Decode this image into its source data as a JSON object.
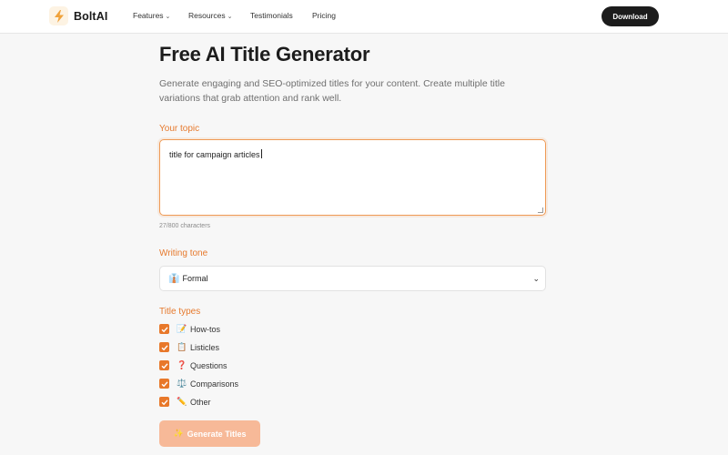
{
  "navbar": {
    "brand": "BoltAI",
    "logo_icon": "lightning-bolt-icon",
    "items": [
      {
        "label": "Features",
        "has_dropdown": true
      },
      {
        "label": "Resources",
        "has_dropdown": true
      },
      {
        "label": "Testimonials",
        "has_dropdown": false
      },
      {
        "label": "Pricing",
        "has_dropdown": false
      }
    ],
    "download_label": "Download"
  },
  "main": {
    "title": "Free AI Title Generator",
    "description": "Generate engaging and SEO-optimized titles for your content. Create multiple title variations that grab attention and rank well.",
    "topic": {
      "label": "Your topic",
      "value": "title for campaign articles",
      "char_count": "27/800 characters"
    },
    "tone": {
      "label": "Writing tone",
      "emoji": "👔",
      "value": "Formal"
    },
    "title_types": {
      "label": "Title types",
      "items": [
        {
          "emoji": "📝",
          "label": "How-tos",
          "checked": true
        },
        {
          "emoji": "📋",
          "label": "Listicles",
          "checked": true
        },
        {
          "emoji": "❓",
          "label": "Questions",
          "checked": true
        },
        {
          "emoji": "⚖️",
          "label": "Comparisons",
          "checked": true
        },
        {
          "emoji": "✏️",
          "label": "Other",
          "checked": true
        }
      ]
    },
    "generate_emoji": "✨",
    "generate_label": "Generate Titles"
  },
  "colors": {
    "accent": "#e8782a",
    "accent_light": "#f7b998",
    "dark_button": "#1c1c1c"
  }
}
